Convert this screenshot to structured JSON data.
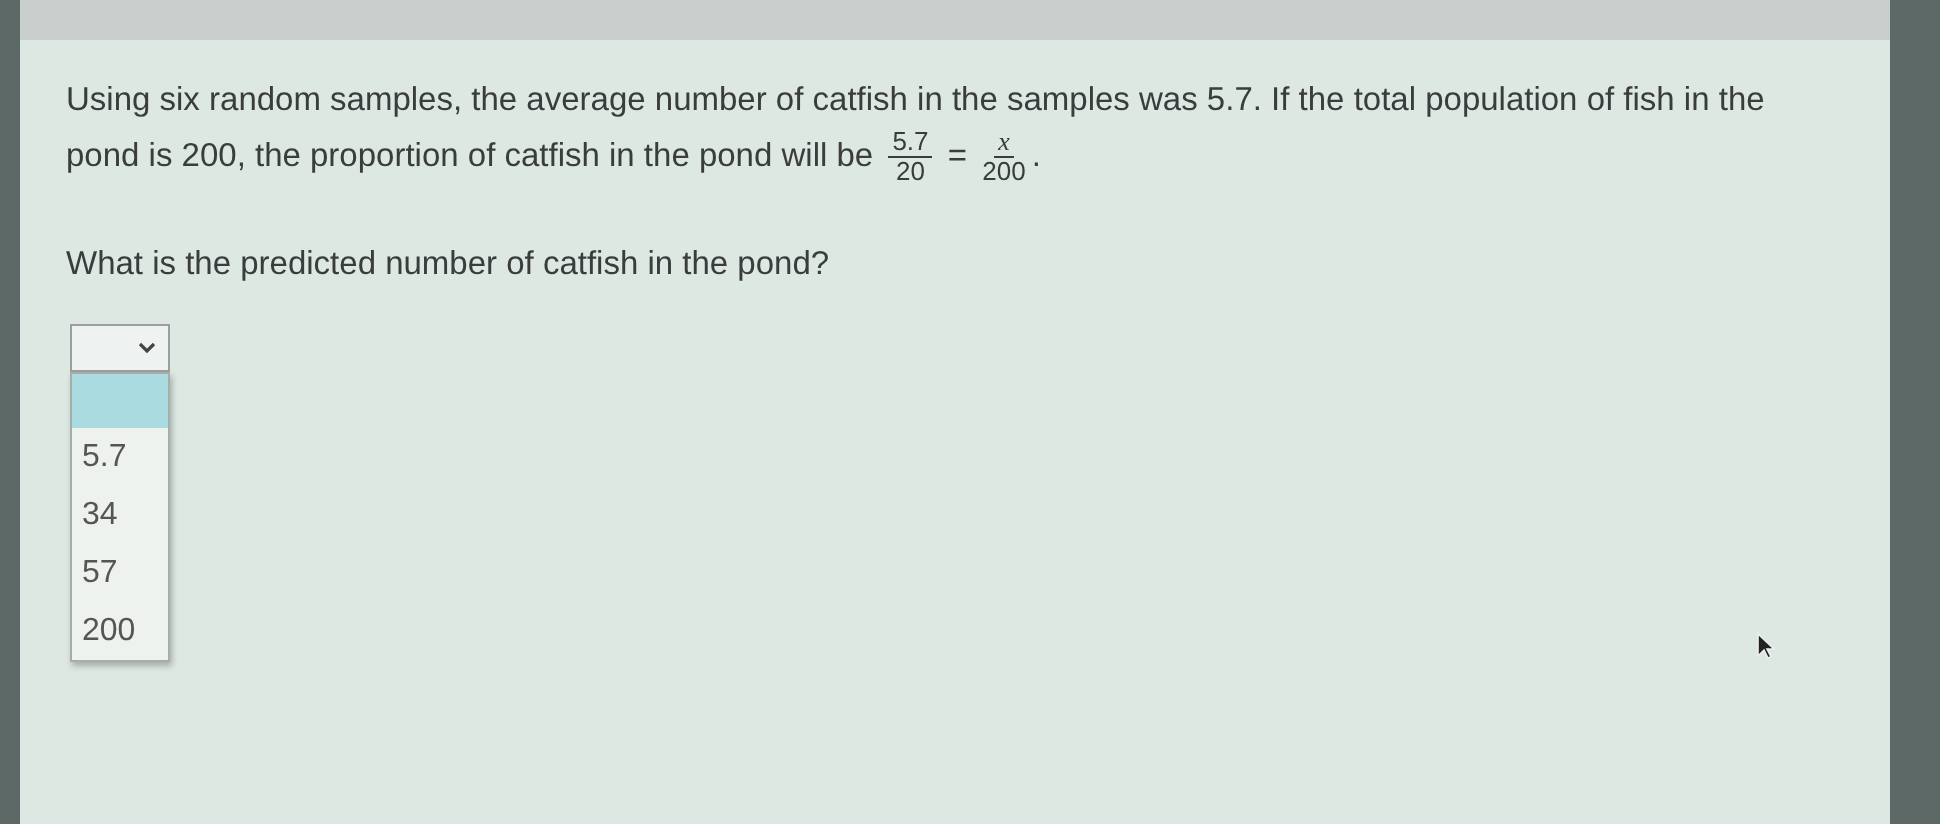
{
  "question": {
    "text_before": "Using six random samples, the average number of catfish in the samples was 5.7. If the total population of fish in the pond is 200, the proportion of catfish in the pond will be",
    "fractions": [
      {
        "numerator": "5.7",
        "denominator": "20"
      },
      {
        "numerator": "x",
        "denominator": "200"
      }
    ],
    "equals": "=",
    "end": ".",
    "prompt": "What is the predicted number of catfish in the pond?"
  },
  "dropdown": {
    "expanded": true,
    "blank_option_highlighted": true,
    "options": [
      {
        "label": "5.7",
        "selected": false
      },
      {
        "label": "34",
        "selected": false
      },
      {
        "label": "57",
        "selected": false
      },
      {
        "label": "200",
        "selected": false
      }
    ]
  }
}
